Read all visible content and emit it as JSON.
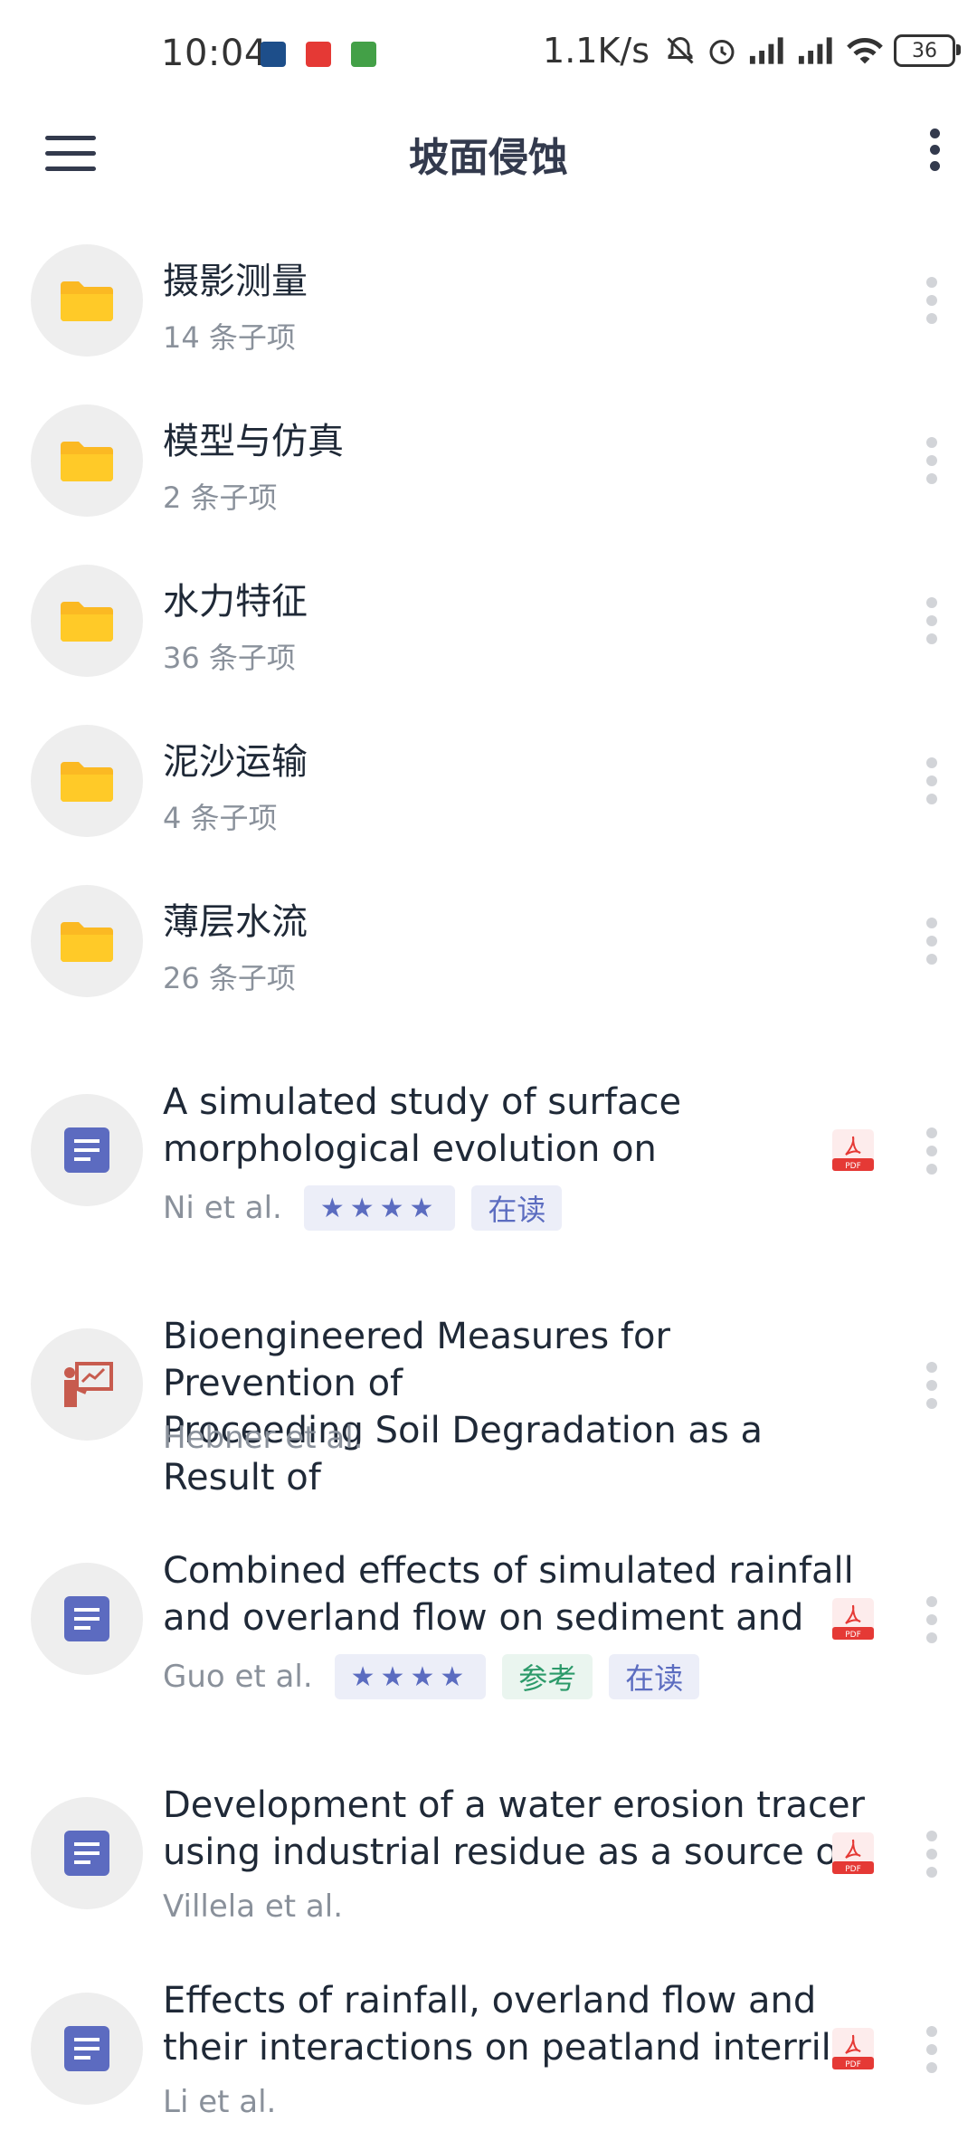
{
  "status_bar": {
    "time": "10:04",
    "net_speed": "1.1K/s",
    "battery": "36"
  },
  "app_bar": {
    "title": "坡面侵蚀",
    "menu_icon": "hamburger-menu-icon",
    "overflow_icon": "more-vert-icon"
  },
  "folders": [
    {
      "name": "摄影测量",
      "count": "14 条子项"
    },
    {
      "name": "模型与仿真",
      "count": "2 条子项"
    },
    {
      "name": "水力特征",
      "count": "36 条子项"
    },
    {
      "name": "泥沙运输",
      "count": "4 条子项"
    },
    {
      "name": "薄层水流",
      "count": "26 条子项"
    }
  ],
  "papers": [
    {
      "line1": "A simulated study of surface",
      "line2": "morphological evolution on",
      "authors": "Ni et al.",
      "stars": "★★★★",
      "tag1": "在读",
      "tag2": "",
      "icon": "document-icon",
      "has_pdf": true
    },
    {
      "line1": "Bioengineered Measures for Prevention of",
      "line2": "Proceeding Soil Degradation as a Result of",
      "authors": "Hebner et al.",
      "stars": "",
      "tag1": "",
      "tag2": "",
      "icon": "presentation-icon",
      "has_pdf": false
    },
    {
      "line1": "Combined effects of simulated rainfall",
      "line2": "and overland flow on sediment and",
      "authors": "Guo et al.",
      "stars": "★★★★",
      "tag1": "参考",
      "tag2": "在读",
      "icon": "document-icon",
      "has_pdf": true
    },
    {
      "line1": "Development of a water erosion tracer",
      "line2": "using industrial residue as a source of",
      "authors": "Villela et al.",
      "stars": "",
      "tag1": "",
      "tag2": "",
      "icon": "document-icon",
      "has_pdf": true
    },
    {
      "line1": "Effects of rainfall, overland flow and",
      "line2": "their interactions on peatland interrill",
      "authors": "Li et al.",
      "stars": "",
      "tag1": "",
      "tag2": "",
      "icon": "document-icon",
      "has_pdf": true
    }
  ],
  "colors": {
    "folder": "#FBB923",
    "document": "#5C6BC0",
    "presentation": "#C75B4E",
    "pdf": "#E53935"
  }
}
